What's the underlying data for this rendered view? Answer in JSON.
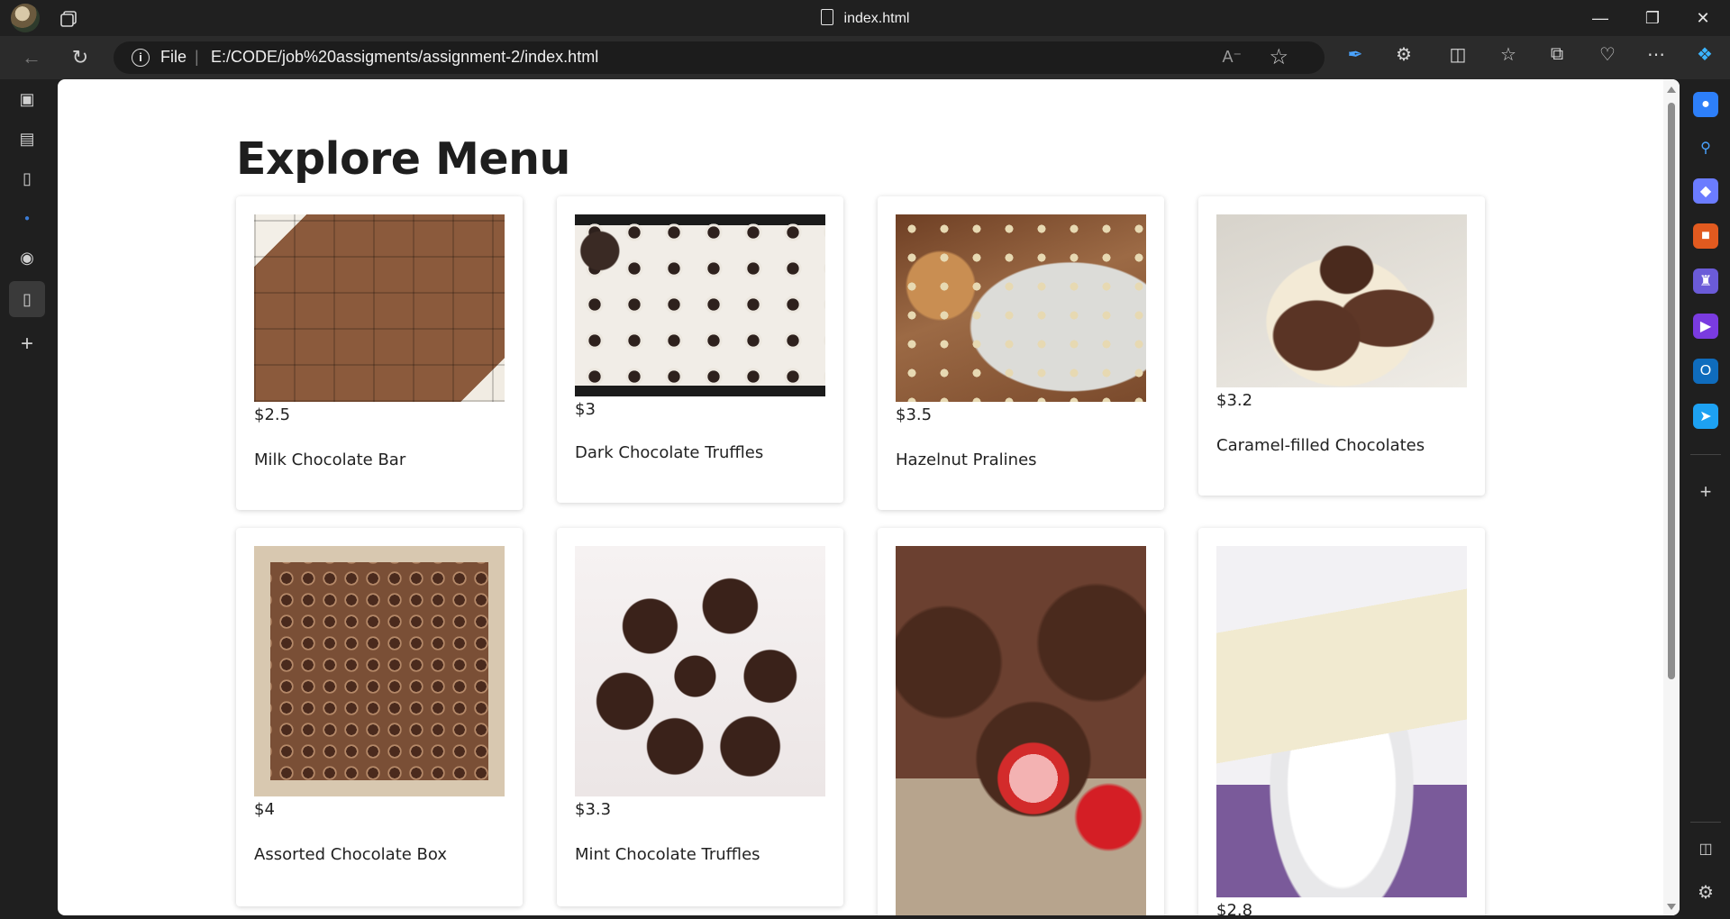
{
  "browser": {
    "tab_title": "index.html",
    "address": {
      "scheme_label": "File",
      "url": "E:/CODE/job%20assigments/assignment-2/index.html"
    }
  },
  "page": {
    "heading": "Explore Menu",
    "items": [
      {
        "price": "$2.5",
        "name": "Milk Chocolate Bar"
      },
      {
        "price": "$3",
        "name": "Dark Chocolate Truffles"
      },
      {
        "price": "$3.5",
        "name": "Hazelnut Pralines"
      },
      {
        "price": "$3.2",
        "name": "Caramel-filled Chocolates"
      },
      {
        "price": "$4",
        "name": "Assorted Chocolate Box"
      },
      {
        "price": "$3.3",
        "name": "Mint Chocolate Truffles"
      },
      {
        "price": "",
        "name": ""
      },
      {
        "price": "$2.8",
        "name": ""
      }
    ]
  },
  "icons": {
    "left_sidebar": [
      "workspaces-icon",
      "downloads-icon",
      "document-icon",
      "github-icon",
      "active-tab-document-icon",
      "new-tab-plus-icon"
    ],
    "right_sidebar": [
      "notifications-icon",
      "search-icon",
      "shopping-tag-icon",
      "tools-icon",
      "games-icon",
      "copilot-icon",
      "outlook-icon",
      "send-icon",
      "add-icon",
      "sidebar-toggle-icon",
      "settings-gear-icon"
    ]
  },
  "colors": {
    "chrome_dark": "#202020",
    "page_background": "#ffffff",
    "text": "#1e1e1e"
  }
}
